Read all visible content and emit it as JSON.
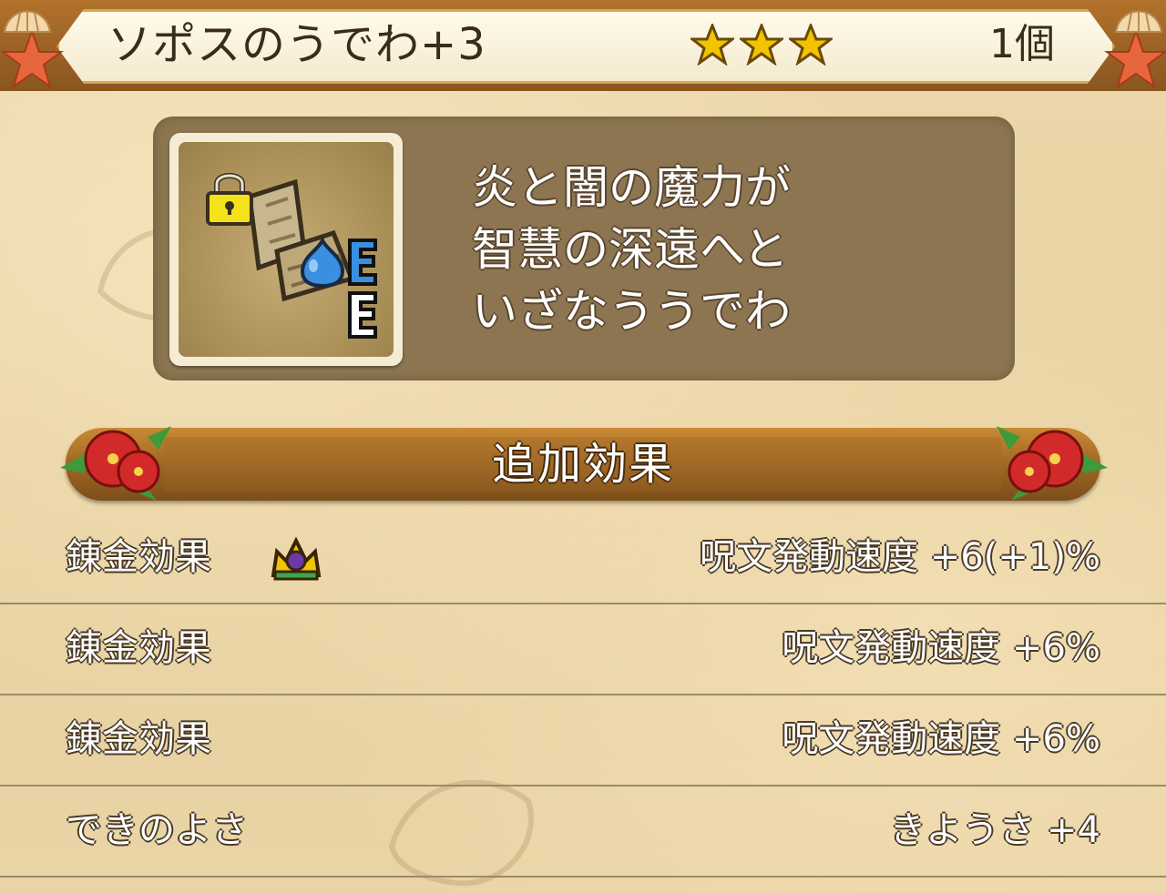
{
  "header": {
    "item_name": "ソポスのうでわ+3",
    "stars": 3,
    "quantity": "1個"
  },
  "item": {
    "icon": "bracelet-icon",
    "badges": [
      "lock-icon",
      "slime-icon",
      "E",
      "E"
    ],
    "description": [
      "炎と闇の魔力が",
      "智慧の深遠へと",
      "いざなううでわ"
    ]
  },
  "section": {
    "title": "追加効果"
  },
  "effects": [
    {
      "label": "錬金効果",
      "value": "呪文発動速度 +6(+1)%",
      "icon": "crown-icon"
    },
    {
      "label": "錬金効果",
      "value": "呪文発動速度 +6%"
    },
    {
      "label": "錬金効果",
      "value": "呪文発動速度 +6%"
    },
    {
      "label": "できのよさ",
      "value": "きようさ +4"
    }
  ],
  "colors": {
    "star": "#f2c400",
    "badge_e": "#3a8fe0",
    "slime": "#3a8fe0",
    "lock": "#f4e21a"
  }
}
